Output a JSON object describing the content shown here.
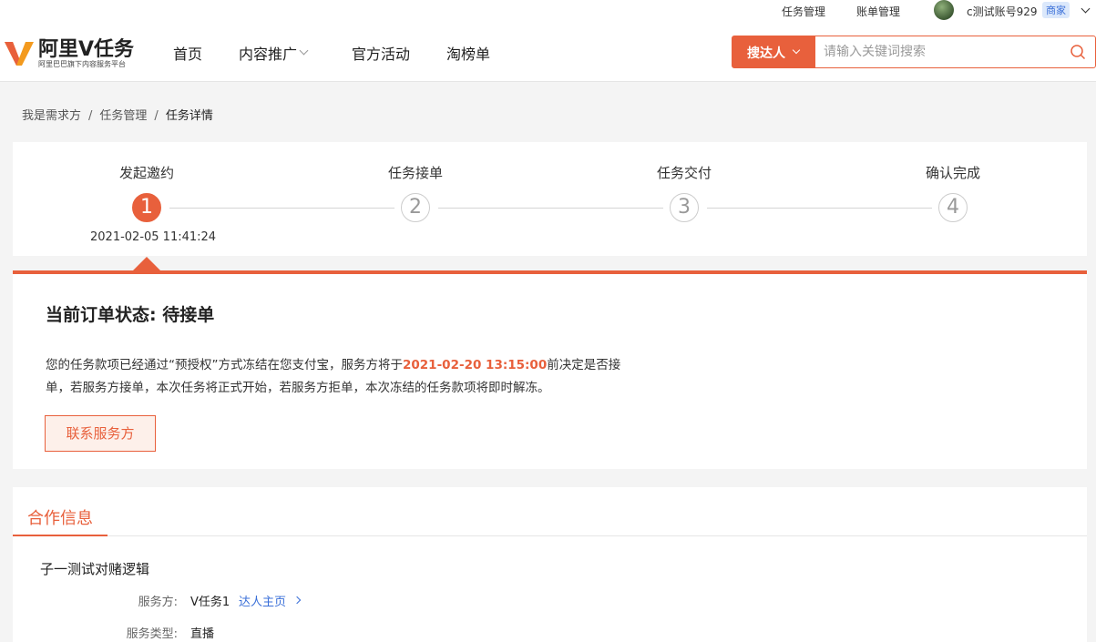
{
  "topbar": {
    "task_mgmt": "任务管理",
    "bill_mgmt": "账单管理",
    "account": "c测试账号929",
    "role_badge": "商家"
  },
  "header": {
    "logo_title": "阿里V任务",
    "logo_subtitle": "阿里巴巴旗下内容服务平台",
    "nav": [
      "首页",
      "内容推广",
      "官方活动",
      "淘榜单"
    ],
    "search_type": "搜达人",
    "search_placeholder": "请输入关键词搜索"
  },
  "breadcrumb": [
    "我是需求方",
    "任务管理",
    "任务详情"
  ],
  "steps": [
    {
      "num": "1",
      "label": "发起邀约",
      "active": true,
      "time": "2021-02-05 11:41:24"
    },
    {
      "num": "2",
      "label": "任务接单",
      "active": false
    },
    {
      "num": "3",
      "label": "任务交付",
      "active": false
    },
    {
      "num": "4",
      "label": "确认完成",
      "active": false
    }
  ],
  "status": {
    "title": "当前订单状态: 待接单",
    "desc_before": "您的任务款项已经通过“预授权”方式冻结在您支付宝，服务方将于",
    "deadline": "2021-02-20 13:15:00",
    "desc_after": "前决定是否接单，若服务方接单，本次任务将正式开始，若服务方拒单，本次冻结的任务款项将即时解冻。",
    "contact_button": "联系服务方"
  },
  "cooperation": {
    "tab": "合作信息",
    "task_name": "子一测试对赌逻辑",
    "provider_label": "服务方:",
    "provider_value": "V任务1",
    "provider_link": "达人主页",
    "service_type_label": "服务类型:",
    "service_type_value": "直播"
  },
  "colors": {
    "accent": "#e8603c",
    "link": "#3a6fd8"
  }
}
